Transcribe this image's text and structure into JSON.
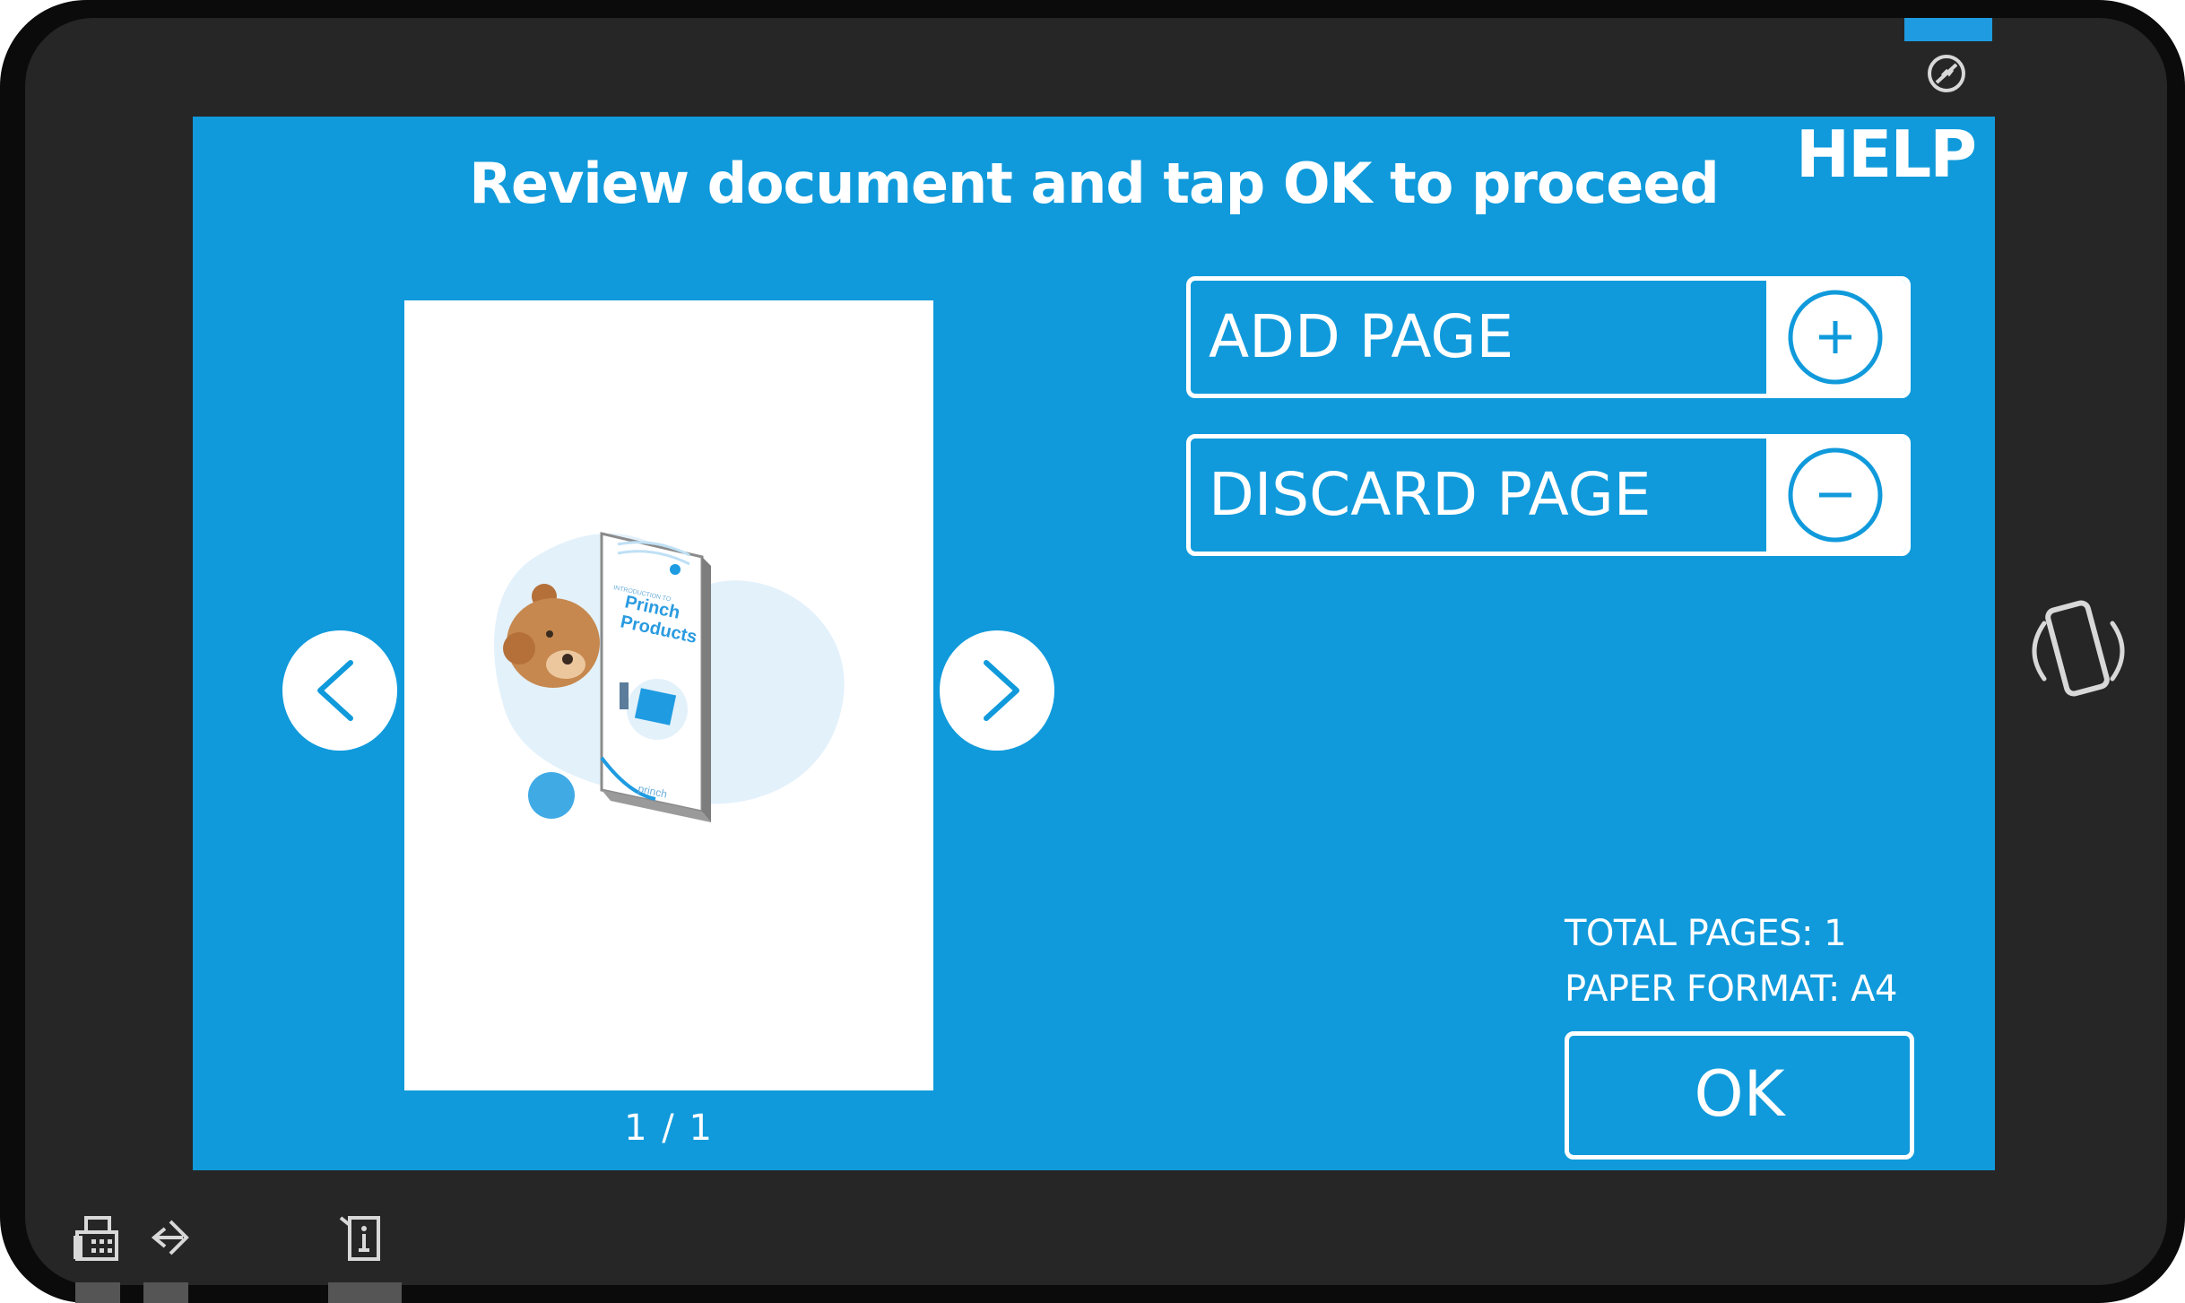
{
  "header": {
    "title": "Review document and tap OK to proceed",
    "help_label": "HELP"
  },
  "preview": {
    "page_counter": "1 / 1",
    "book_kicker": "INTRODUCTION TO",
    "book_title_line1": "Princh",
    "book_title_line2": "Products",
    "book_brand": "princh"
  },
  "actions": {
    "add_page_label": "ADD PAGE",
    "discard_page_label": "DISCARD PAGE"
  },
  "summary": {
    "total_pages": "TOTAL PAGES: 1",
    "paper_format": "PAPER FORMAT: A4"
  },
  "ok_label": "OK",
  "icons": {
    "power": "power-icon",
    "prev": "chevron-left-icon",
    "next": "chevron-right-icon",
    "add": "plus-circle-icon",
    "discard": "minus-circle-icon",
    "phone": "phone-vibrate-icon",
    "fax": "fax-icon",
    "login": "sign-in-icon",
    "info": "device-info-icon"
  },
  "colors": {
    "screen_bg": "#109adb",
    "accent": "#1e9be1",
    "bezel": "#262626"
  }
}
